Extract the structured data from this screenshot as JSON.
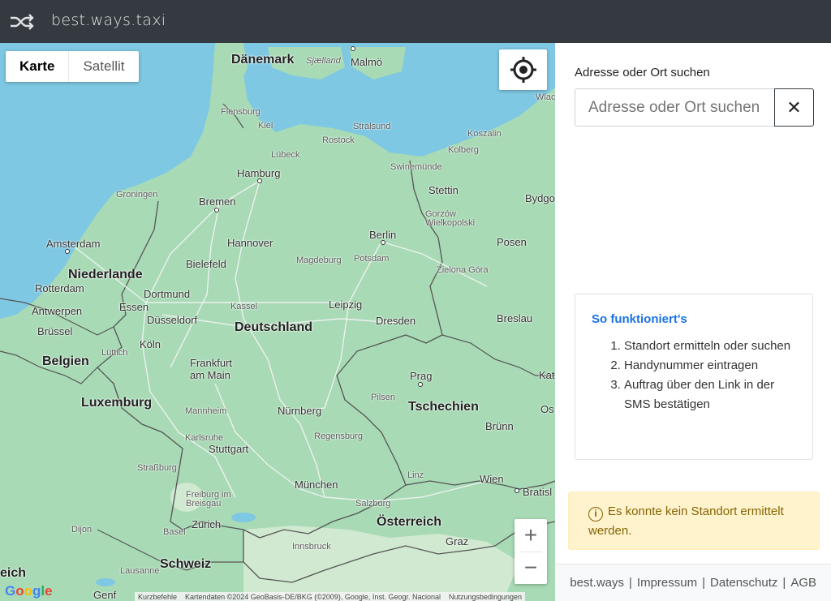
{
  "navbar": {
    "brand": "best.ways.taxi",
    "icon": "shuffle-icon"
  },
  "map": {
    "type_control": {
      "map_label": "Karte",
      "satellite_label": "Satellit",
      "active": "Karte"
    },
    "locate_icon": "crosshair-icon",
    "zoom": {
      "in": "+",
      "out": "−"
    },
    "logo": "Google",
    "attribution": {
      "shortcuts": "Kurzbefehle",
      "data": "Kartendaten ©2024 GeoBasis-DE/BKG (©2009), Google, Inst. Geogr. Nacional",
      "terms": "Nutzungsbedingungen"
    },
    "colors": {
      "land": "#a8dab5",
      "water": "#7ec8e3",
      "border": "#555555"
    },
    "labels": {
      "daenemark": "Dänemark",
      "sjaelland": "Sjælland",
      "malmoe": "Malmö",
      "flensburg": "Flensburg",
      "kiel": "Kiel",
      "stralsund": "Stralsund",
      "koszalin": "Koszalin",
      "rostock": "Rostock",
      "kolberg": "Kolberg",
      "luebeck": "Lübeck",
      "hamburg": "Hamburg",
      "swinemuende": "Swinemünde",
      "stettin": "Stettin",
      "groningen": "Groningen",
      "bremen": "Bremen",
      "bydgo": "Bydgo",
      "gorzow": "Gorzów Wielkopolski",
      "amsterdam": "Amsterdam",
      "berlin": "Berlin",
      "hannover": "Hannover",
      "posen": "Posen",
      "niederlande": "Niederlande",
      "bielefeld": "Bielefeld",
      "magdeburg": "Magdeburg",
      "potsdam": "Potsdam",
      "zielona": "Zielona Góra",
      "rotterdam": "Rotterdam",
      "dortmund": "Dortmund",
      "essen": "Essen",
      "kassel": "Kassel",
      "leipzig": "Leipzig",
      "antwerpen": "Antwerpen",
      "duesseldorf": "Düsseldorf",
      "deutschland": "Deutschland",
      "dresden": "Dresden",
      "breslau": "Breslau",
      "bruessel": "Brüssel",
      "koeln": "Köln",
      "luettich": "Lüttich",
      "belgien": "Belgien",
      "frankfurt": "Frankfurt am Main",
      "prag": "Prag",
      "kat": "Kat",
      "pilsen": "Pilsen",
      "luxemburg": "Luxemburg",
      "tschechien": "Tschechien",
      "os": "Os",
      "mannheim": "Mannheim",
      "nuernberg": "Nürnberg",
      "bruenn": "Brünn",
      "karlsruhe": "Karlsruhe",
      "stuttgart": "Stuttgart",
      "regensburg": "Regensburg",
      "strassburg": "Straßburg",
      "linz": "Linz",
      "wien": "Wien",
      "bratisl": "Bratisl",
      "muenchen": "München",
      "freiburg": "Freiburg im Breisgau",
      "salzburg": "Salzburg",
      "zuerich": "Zürich",
      "oesterreich": "Österreich",
      "dijon": "Dijon",
      "basel": "Basel",
      "graz": "Graz",
      "innsbruck": "Innsbruck",
      "schweiz": "Schweiz",
      "eich": "eich",
      "lausanne": "Lausanne",
      "genf": "Genf",
      "wlac": "Wlac"
    }
  },
  "sidebar": {
    "search_label": "Adresse oder Ort suchen",
    "search_placeholder": "Adresse oder Ort suchen",
    "clear_label": "✕",
    "howto": {
      "title": "So funktioniert's",
      "steps": [
        "Standort ermitteln oder suchen",
        "Handynummer eintragen",
        "Auftrag über den Link in der SMS bestätigen"
      ]
    },
    "alert": {
      "icon": "info-icon",
      "text": "Es konnte kein Standort ermittelt werden."
    },
    "footer": {
      "brand": "best.ways",
      "impressum": "Impressum",
      "datenschutz": "Datenschutz",
      "agb": "AGB"
    }
  }
}
